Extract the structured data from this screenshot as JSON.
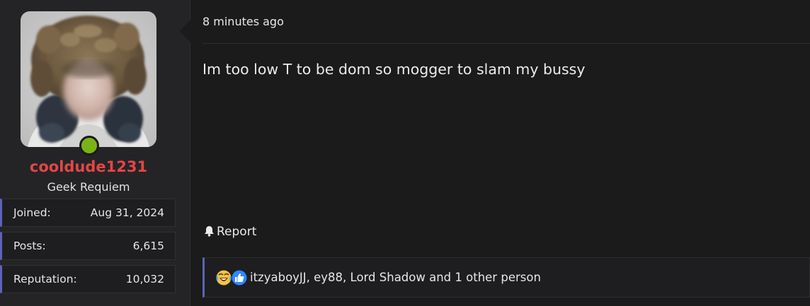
{
  "author": {
    "username": "cooldude1231",
    "title": "Geek Requiem",
    "online": true,
    "username_color": "#e34646",
    "stats": [
      {
        "label": "Joined:",
        "value": "Aug 31, 2024"
      },
      {
        "label": "Posts:",
        "value": "6,615"
      },
      {
        "label": "Reputation:",
        "value": "10,032"
      }
    ]
  },
  "post": {
    "time": "8 minutes ago",
    "message": "Im too low T to be dom so mogger to slam my bussy",
    "report_label": "Report",
    "report_icon": "bell-icon"
  },
  "reactions": {
    "icons": [
      "laughing-crying-emoji-icon",
      "thumbs-up-icon"
    ],
    "users_text": "itzyaboyJJ, ey88, Lord Shadow and 1 other person"
  },
  "colors": {
    "accent": "#5c64b7",
    "online": "#7ab317",
    "background": "#1b1b1c",
    "sidebar": "#242426"
  }
}
